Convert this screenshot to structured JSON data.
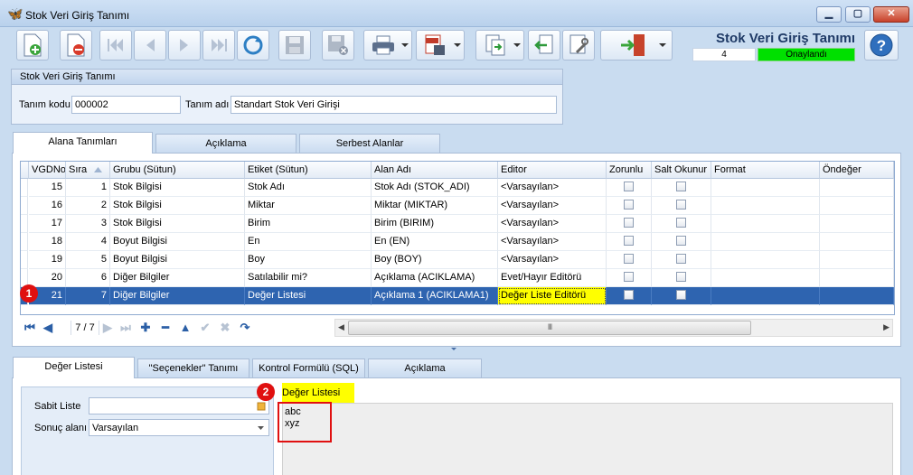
{
  "window": {
    "title": "Stok Veri Giriş Tanımı",
    "icon": "butterfly-icon",
    "controls": {
      "minimize": "▁",
      "maximize": "▢",
      "close": "✕"
    }
  },
  "toolbar": {
    "buttons": [
      {
        "name": "new-document-icon",
        "enabled": true
      },
      {
        "name": "delete-document-icon",
        "enabled": true
      },
      {
        "name": "first-record-icon",
        "enabled": false
      },
      {
        "name": "previous-record-icon",
        "enabled": false
      },
      {
        "name": "next-record-icon",
        "enabled": false
      },
      {
        "name": "last-record-icon",
        "enabled": false
      },
      {
        "name": "refresh-icon",
        "enabled": true
      },
      {
        "name": "save-icon",
        "enabled": false
      },
      {
        "name": "save-cancel-icon",
        "enabled": false
      },
      {
        "name": "print-icon",
        "enabled": true
      },
      {
        "name": "pdf-export-icon",
        "enabled": true
      },
      {
        "name": "export-icon",
        "enabled": true
      },
      {
        "name": "import-icon",
        "enabled": true
      },
      {
        "name": "settings-icon",
        "enabled": true
      },
      {
        "name": "exit-door-icon",
        "enabled": true
      }
    ],
    "form_title": "Stok Veri Giriş Tanımı",
    "record_count": "4",
    "status": "Onaylandı",
    "status_color": "#00e000",
    "help_icon": "help-icon"
  },
  "definition": {
    "group_title": "Stok Veri Giriş Tanımı",
    "code_label": "Tanım kodu",
    "code_value": "000002",
    "name_label": "Tanım adı",
    "name_value": "Standart Stok Veri Girişi"
  },
  "top_tabs": [
    {
      "label": "Alana Tanımları",
      "active": true
    },
    {
      "label": "Açıklama",
      "active": false
    },
    {
      "label": "Serbest Alanlar",
      "active": false
    }
  ],
  "grid": {
    "columns": [
      "VGDNo",
      "Sıra",
      "Grubu (Sütun)",
      "Etiket (Sütun)",
      "Alan Adı",
      "Editor",
      "Zorunlu",
      "Salt Okunur",
      "Format",
      "Öndeğer"
    ],
    "rows": [
      {
        "vgdno": "15",
        "sira": "1",
        "grubu": "Stok Bilgisi",
        "etiket": "Stok Adı",
        "alan": "Stok Adı (STOK_ADI)",
        "editor": "<Varsayılan>",
        "selected": false
      },
      {
        "vgdno": "16",
        "sira": "2",
        "grubu": "Stok Bilgisi",
        "etiket": "Miktar",
        "alan": "Miktar (MIKTAR)",
        "editor": "<Varsayılan>",
        "selected": false
      },
      {
        "vgdno": "17",
        "sira": "3",
        "grubu": "Stok Bilgisi",
        "etiket": "Birim",
        "alan": "Birim (BIRIM)",
        "editor": "<Varsayılan>",
        "selected": false
      },
      {
        "vgdno": "18",
        "sira": "4",
        "grubu": "Boyut Bilgisi",
        "etiket": "En",
        "alan": "En (EN)",
        "editor": "<Varsayılan>",
        "selected": false
      },
      {
        "vgdno": "19",
        "sira": "5",
        "grubu": "Boyut Bilgisi",
        "etiket": "Boy",
        "alan": "Boy (BOY)",
        "editor": "<Varsayılan>",
        "selected": false
      },
      {
        "vgdno": "20",
        "sira": "6",
        "grubu": "Diğer Bilgiler",
        "etiket": "Satılabilir mi?",
        "alan": "Açıklama (ACIKLAMA)",
        "editor": "Evet/Hayır Editörü",
        "selected": false
      },
      {
        "vgdno": "21",
        "sira": "7",
        "grubu": "Diğer Bilgiler",
        "etiket": "Değer Listesi",
        "alan": "Açıklama 1 (ACIKLAMA1)",
        "editor": "Değer Liste Editörü",
        "selected": true
      }
    ],
    "navigator": {
      "position": "7 / 7",
      "scroll_grip": "III"
    }
  },
  "bottom_tabs": [
    {
      "label": "Değer Listesi",
      "active": true
    },
    {
      "label": "\"Seçenekler\" Tanımı",
      "active": false
    },
    {
      "label": "Kontrol Formülü (SQL)",
      "active": false
    },
    {
      "label": "Açıklama",
      "active": false
    }
  ],
  "value_list": {
    "sabit_label": "Sabit Liste",
    "sabit_value": "",
    "sonuc_label": "Sonuç alanı",
    "sonuc_value": "Varsayılan",
    "list_header": "Değer Listesi",
    "items": [
      "abc",
      "xyz"
    ]
  },
  "annotations": {
    "marker1": "1",
    "marker2": "2",
    "color": "#e01010"
  }
}
